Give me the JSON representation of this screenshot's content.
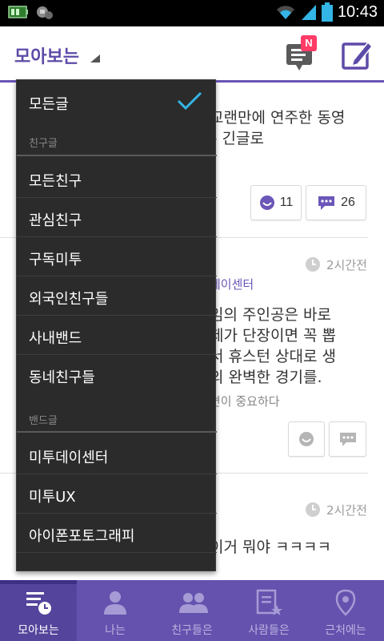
{
  "status_bar": {
    "time": "10:43"
  },
  "header": {
    "title": "모아보는",
    "notif_badge": "N"
  },
  "feed": {
    "post1_line1": "교랜만에 연주한 동영",
    "post1_line2": "– 긴글로",
    "post1_emotion_count": "11",
    "post1_comment_count": "26",
    "post2_time": "2시간전",
    "post2_band": "데이센터",
    "post2_line1": "임의 주인공은 바로",
    "post2_line2": "제가 단장이면 꼭 뽑",
    "post2_line3": "서 휴스턴 상대로 생",
    "post2_line4": "의 완벽한 경기를.",
    "post2_sub": "면이 중요하다",
    "post3_time": "2시간전",
    "post3_line1": "이거 뭐야 ㅋㅋㅋㅋ"
  },
  "dropdown": {
    "all_posts": "모든글",
    "friends_section": "친구글",
    "friend_items": [
      "모든친구",
      "관심친구",
      "구독미투",
      "외국인친구들",
      "사내밴드",
      "동네친구들"
    ],
    "band_section": "밴드글",
    "band_items": [
      "미투데이센터",
      "미투UX",
      "아이폰포토그래피"
    ]
  },
  "bottom_nav": [
    {
      "label": "모아보는",
      "icon": "feed-list-icon",
      "active": true
    },
    {
      "label": "나는",
      "icon": "person-icon",
      "active": false
    },
    {
      "label": "친구들은",
      "icon": "friends-icon",
      "active": false
    },
    {
      "label": "사람들은",
      "icon": "people-star-icon",
      "active": false
    },
    {
      "label": "근처에는",
      "icon": "location-pin-icon",
      "active": false
    }
  ],
  "colors": {
    "brand_purple": "#6552ae",
    "dropdown_bg": "#2b2b2b",
    "check_blue": "#33b5e5",
    "badge_pink": "#ff3b67"
  }
}
